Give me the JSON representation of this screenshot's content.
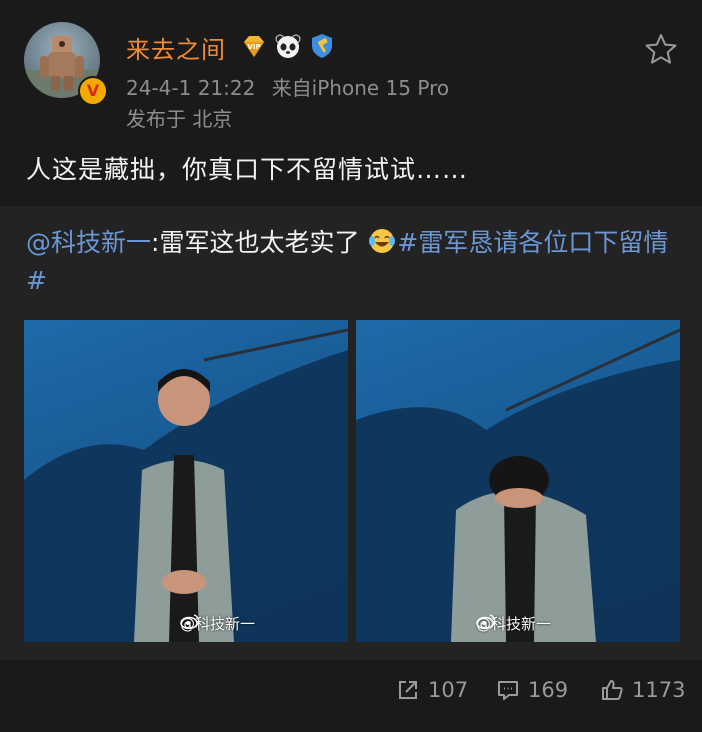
{
  "author": {
    "name": "来去之间",
    "badges": [
      "vip-diamond-icon",
      "panda-icon",
      "hammer-badge-icon"
    ]
  },
  "meta": {
    "time": "24-4-1 21:22",
    "source": "来自iPhone 15 Pro",
    "location": "发布于 北京"
  },
  "post": {
    "text": "人这是藏拙，你真口下不留情试试……"
  },
  "repost": {
    "mention": "@科技新一",
    "body": ":雷军这也太老实了",
    "emoji": "laughing-crying-emoji",
    "hashtag": "#雷军恳请各位口下留情#"
  },
  "images": [
    {
      "watermark": "@科技新一"
    },
    {
      "watermark": "@科技新一"
    }
  ],
  "stats": {
    "shares": "107",
    "comments": "169",
    "likes": "1173"
  },
  "colors": {
    "username": "#f08a3a",
    "link": "#6b97d6",
    "background": "#1a1a1a",
    "repost_background": "#232323"
  }
}
